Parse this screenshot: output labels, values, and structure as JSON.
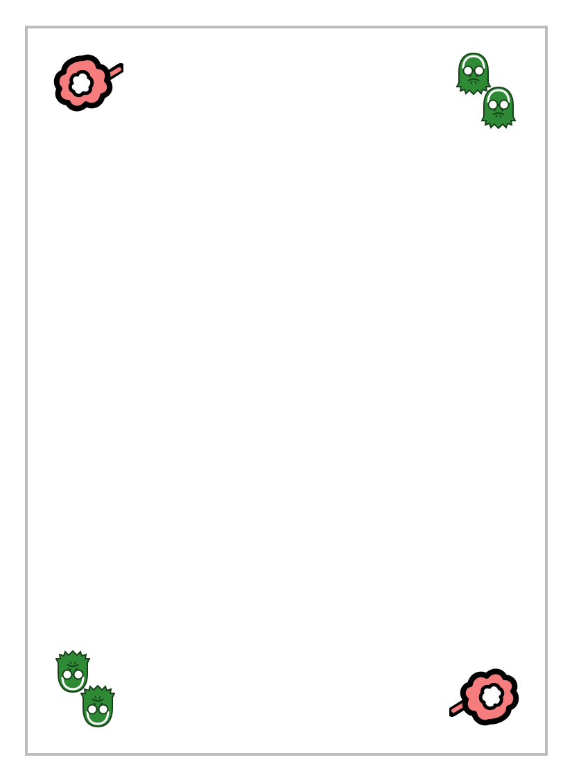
{
  "card": {
    "border_color": "#bdbdbd",
    "background": "#ffffff"
  },
  "icons": {
    "burst": "puff-burst-icon",
    "face": "goblin-face-icon"
  },
  "colors": {
    "burst_fill": "#f67d7d",
    "burst_outline": "#000000",
    "face_dark": "#1e5e23",
    "face_mid": "#2f8a35",
    "face_light": "#ffffff"
  }
}
